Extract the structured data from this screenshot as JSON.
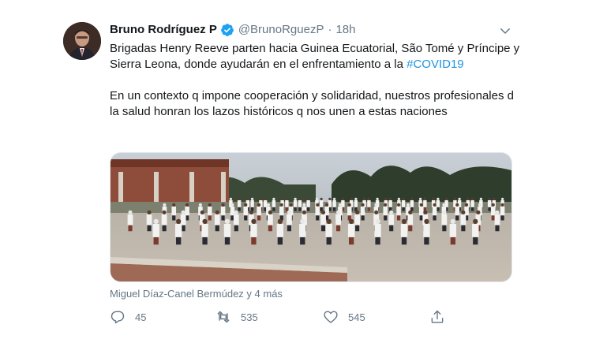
{
  "tweet": {
    "author_name": "Bruno Rodríguez P",
    "handle": "@BrunoRguezP",
    "separator": "·",
    "time": "18h",
    "text_line1": "Brigadas Henry Reeve parten hacia Guinea Ecuatorial, São Tomé y Príncipe y Sierra Leona, donde ayudarán en el enfrentamiento a la",
    "hashtag": "#COVID19",
    "text_paragraph2": "En un contexto q impone cooperación y solidaridad, nuestros profesionales d la salud honran los lazos históricos q nos unen a estas naciones",
    "tagged": "Miguel Díaz-Canel Bermúdez y 4 más",
    "reply_count": "45",
    "retweet_count": "535",
    "like_count": "545"
  },
  "icons": {
    "verified": "verified-badge-icon",
    "caret": "chevron-down-icon",
    "reply": "reply-icon",
    "retweet": "retweet-icon",
    "like": "heart-icon",
    "share": "share-icon"
  },
  "colors": {
    "accent": "#1da1f2",
    "hashtag": "#1b95e0",
    "secondary_text": "#657786",
    "primary_text": "#14171a"
  }
}
